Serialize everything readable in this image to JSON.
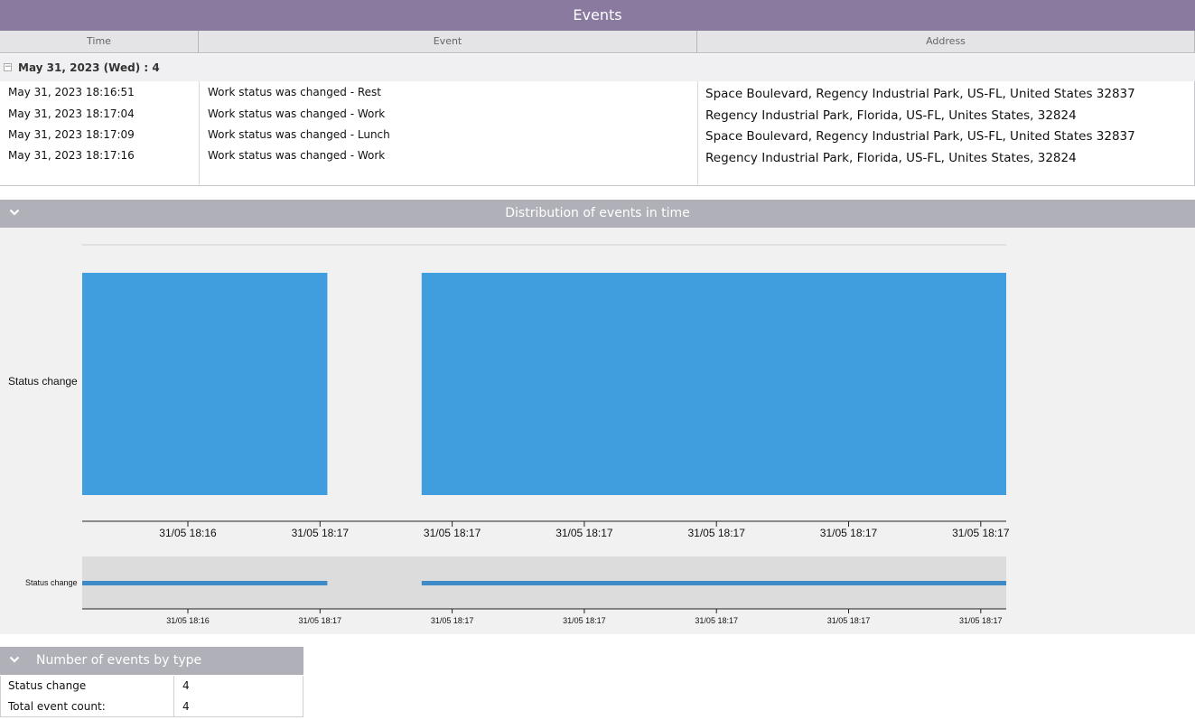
{
  "header": {
    "title": "Events"
  },
  "table": {
    "columns": [
      "Time",
      "Event",
      "Address"
    ],
    "group": {
      "toggle": "−",
      "label": "May 31, 2023 (Wed) : 4"
    },
    "rows": [
      {
        "time": "May 31, 2023 18:16:51",
        "event": "Work status was changed - Rest",
        "address": "Space Boulevard, Regency Industrial Park, US-FL, United States 32837"
      },
      {
        "time": "May 31, 2023 18:17:04",
        "event": "Work status was changed - Work",
        "address": "Regency Industrial Park, Florida, US-FL, Unites States, 32824"
      },
      {
        "time": "May 31, 2023 18:17:09",
        "event": "Work status was changed - Lunch",
        "address": "Space Boulevard, Regency Industrial Park, US-FL, United States 32837"
      },
      {
        "time": "May 31, 2023 18:17:16",
        "event": "Work status was changed - Work",
        "address": "Regency Industrial Park, Florida, US-FL, Unites States, 32824"
      }
    ]
  },
  "distribution": {
    "title": "Distribution of events in time",
    "icon": "chevron-down-icon"
  },
  "chart_data": {
    "type": "bar",
    "series_label": "Status change",
    "main_x_ticks": [
      "31/05 18:16",
      "31/05 18:17",
      "31/05 18:17",
      "31/05 18:17",
      "31/05 18:17",
      "31/05 18:17",
      "31/05 18:17"
    ],
    "overview_label": "Status change",
    "overview_x_ticks": [
      "31/05 18:16",
      "31/05 18:17",
      "31/05 18:17",
      "31/05 18:17",
      "31/05 18:17",
      "31/05 18:17",
      "31/05 18:17"
    ],
    "segments": [
      {
        "start": "2023-05-31 18:16:51",
        "end": "2023-05-31 18:17:04"
      },
      {
        "start": "2023-05-31 18:17:09",
        "end": "2023-05-31 18:17:40"
      }
    ],
    "bar_color": "#409ede",
    "overview_bar_color": "#3f8bc8"
  },
  "types": {
    "title": "Number of events by type",
    "icon": "chevron-down-icon",
    "rows": [
      {
        "label": "Status change",
        "value": "4"
      },
      {
        "label": "Total event count:",
        "value": "4"
      }
    ]
  }
}
